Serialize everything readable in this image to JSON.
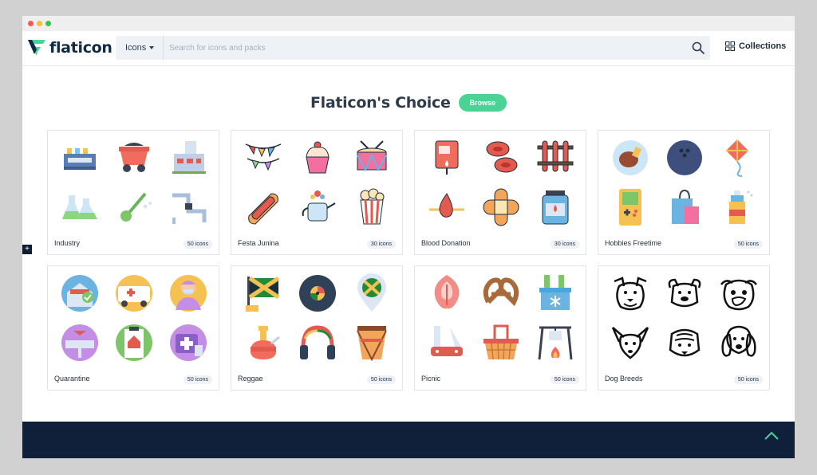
{
  "brand": {
    "name": "flaticon",
    "green": "#4ad395",
    "navy": "#0e2a47"
  },
  "search": {
    "type_label": "Icons",
    "placeholder": "Search for icons and packs",
    "value": ""
  },
  "header": {
    "collections_label": "Collections"
  },
  "section": {
    "title": "Flaticon's Choice",
    "browse_label": "Browse"
  },
  "packs": [
    {
      "name": "Industry",
      "count": "50 icons"
    },
    {
      "name": "Festa Junina",
      "count": "30 icons"
    },
    {
      "name": "Blood Donation",
      "count": "30 icons"
    },
    {
      "name": "Hobbies Freetime",
      "count": "50 icons"
    },
    {
      "name": "Quarantine",
      "count": "50 icons"
    },
    {
      "name": "Reggae",
      "count": "50 icons"
    },
    {
      "name": "Picnic",
      "count": "50 icons"
    },
    {
      "name": "Dog Breeds",
      "count": "50 icons"
    }
  ],
  "icons": {
    "industry": [
      "control-panel-icon",
      "mine-cart-icon",
      "factory-icon",
      "flasks-icon",
      "guitar-tool-icon",
      "pipes-icon"
    ],
    "festa_junina": [
      "bunting-icon",
      "cupcake-icon",
      "drum-icon",
      "hot-dog-icon",
      "watering-can-icon",
      "popcorn-icon"
    ],
    "blood_donation": [
      "blood-bag-icon",
      "blood-cells-icon",
      "test-tubes-icon",
      "blood-drop-icon",
      "bandage-icon",
      "blood-jar-icon"
    ],
    "hobbies": [
      "steak-plate-icon",
      "bowling-ball-icon",
      "kite-icon",
      "game-console-icon",
      "shopping-bag-icon",
      "paint-spray-icon"
    ],
    "quarantine": [
      "home-icon",
      "ambulance-icon",
      "doctor-icon",
      "sink-icon",
      "clipboard-house-icon",
      "first-aid-kit-icon"
    ],
    "reggae": [
      "jamaica-flag-icon",
      "vinyl-icon",
      "jamaica-pin-icon",
      "bong-icon",
      "headphones-icon",
      "bongo-drum-icon"
    ],
    "picnic": [
      "salmon-icon",
      "pretzel-icon",
      "cooler-icon",
      "knife-icon",
      "basket-icon",
      "campfire-icon"
    ],
    "dog_breeds": [
      "bulldog-icon",
      "boxer-dog-icon",
      "pug-icon",
      "chihuahua-icon",
      "shar-pei-icon",
      "cocker-spaniel-icon"
    ]
  },
  "colors": {
    "footer": "#10203a",
    "card_border": "#e1e5ea",
    "badge_bg": "#eef1f5"
  }
}
